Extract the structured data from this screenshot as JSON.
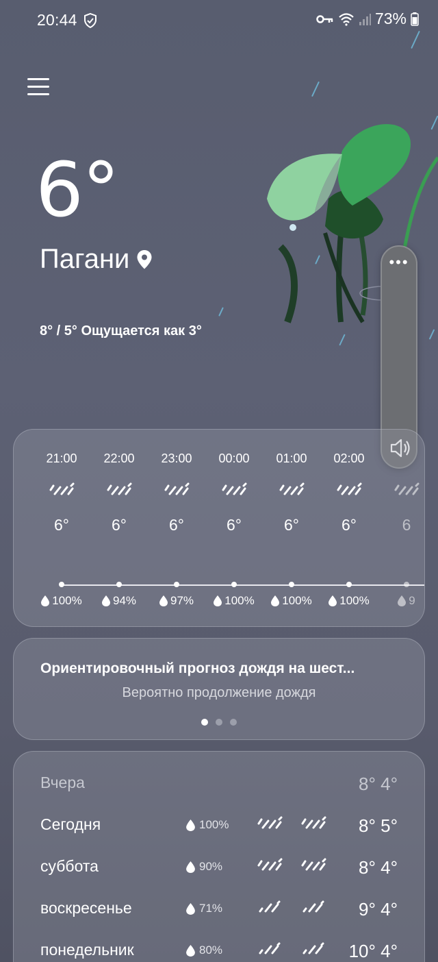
{
  "status_bar": {
    "time": "20:44",
    "battery": "73%",
    "icons": [
      "shield-check-icon",
      "vpn-key-icon",
      "wifi-icon",
      "signal-icon",
      "battery-icon"
    ]
  },
  "current": {
    "temperature": "6°",
    "city": "Пагани",
    "summary": "8° / 5° Ощущается как 3°"
  },
  "hourly": [
    {
      "time": "21:00",
      "temp": "6°",
      "precip": "100%"
    },
    {
      "time": "22:00",
      "temp": "6°",
      "precip": "94%"
    },
    {
      "time": "23:00",
      "temp": "6°",
      "precip": "97%"
    },
    {
      "time": "00:00",
      "temp": "6°",
      "precip": "100%"
    },
    {
      "time": "01:00",
      "temp": "6°",
      "precip": "100%"
    },
    {
      "time": "02:00",
      "temp": "6°",
      "precip": "100%"
    },
    {
      "time": "",
      "temp": "6",
      "precip": "9"
    }
  ],
  "rain_forecast": {
    "title": "Ориентировочный прогноз дождя на шест...",
    "subtitle": "Вероятно продолжение дождя",
    "pages": 3,
    "active_page": 0
  },
  "daily": [
    {
      "day": "Вчера",
      "precip": "",
      "temps": "8° 4°",
      "muted": true
    },
    {
      "day": "Сегодня",
      "precip": "100%",
      "temps": "8° 5°"
    },
    {
      "day": "суббота",
      "precip": "90%",
      "temps": "8° 4°"
    },
    {
      "day": "воскресенье",
      "precip": "71%",
      "temps": "9° 4°"
    },
    {
      "day": "понедельник",
      "precip": "80%",
      "temps": "10° 4°"
    }
  ],
  "colors": {
    "background": "#5a5e70",
    "card": "#7a7d8c",
    "rain_streak": "#6fb7d6",
    "leaf_green": "#4caf6a"
  }
}
